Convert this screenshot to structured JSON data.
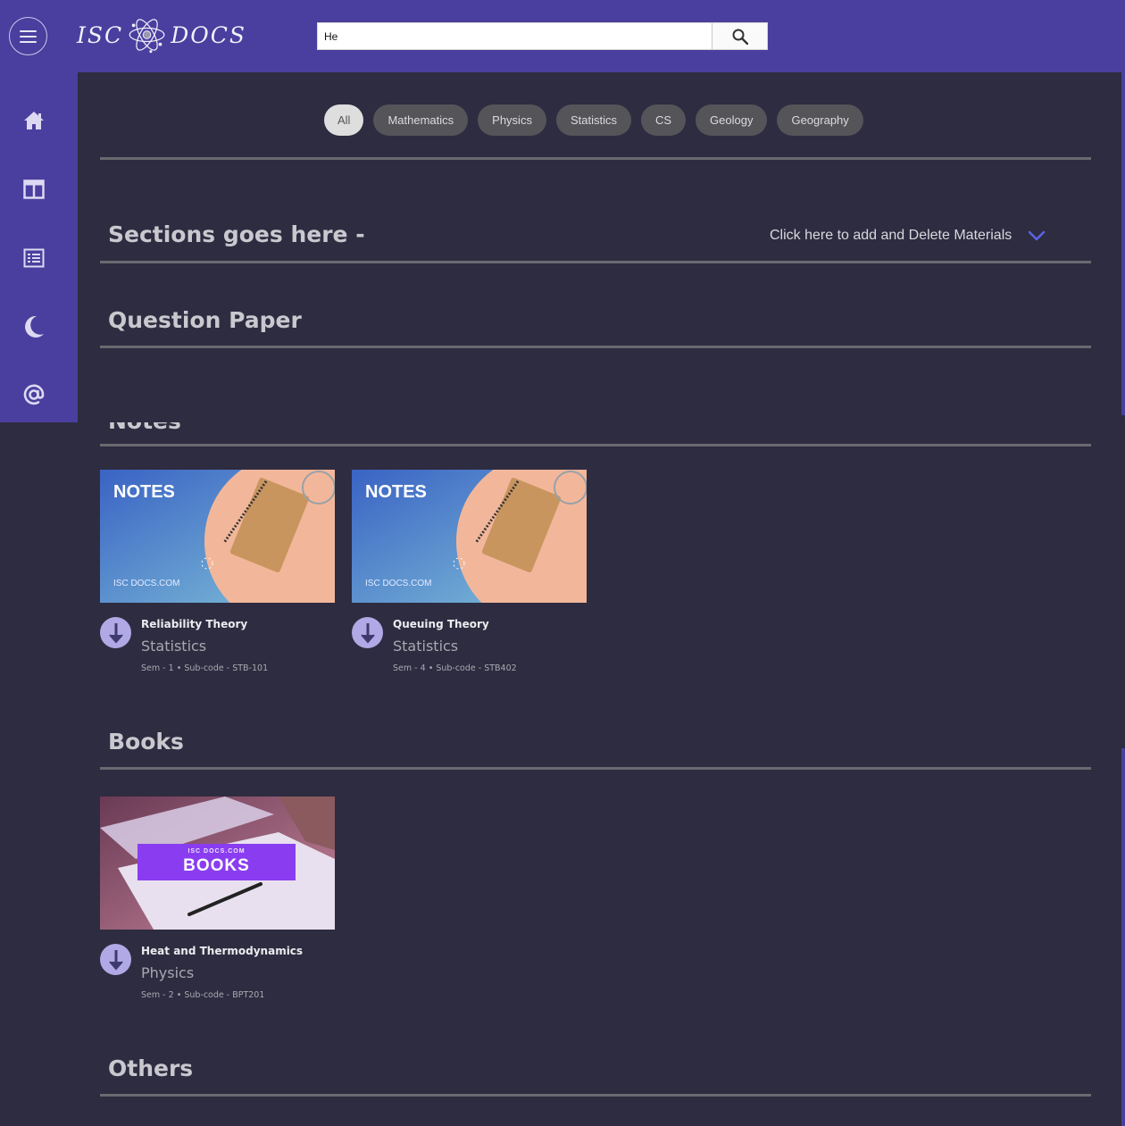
{
  "header": {
    "logo_left": "ISC",
    "logo_right": "DOCS",
    "search": {
      "value": "He"
    }
  },
  "sidebar": {
    "items": [
      {
        "name": "home",
        "icon": "home-icon"
      },
      {
        "name": "dashboard",
        "icon": "columns-icon"
      },
      {
        "name": "list",
        "icon": "list-icon"
      },
      {
        "name": "theme",
        "icon": "moon-icon"
      },
      {
        "name": "contact",
        "icon": "at-icon"
      }
    ]
  },
  "filters": [
    "All",
    "Mathematics",
    "Physics",
    "Statistics",
    "CS",
    "Geology",
    "Geography"
  ],
  "sections": {
    "title": "Sections goes here -",
    "add_link": "Click here to add and Delete Materials",
    "question_paper": "Question Paper",
    "notes": "Notes",
    "books": "Books",
    "others": "Others"
  },
  "notes": [
    {
      "thumb_label": "NOTES",
      "thumb_site": "ISC DOCS.COM",
      "title": "Reliability Theory",
      "subject": "Statistics",
      "sem": "Sem - 1",
      "subcode": "Sub-code - STB-101"
    },
    {
      "thumb_label": "NOTES",
      "thumb_site": "ISC DOCS.COM",
      "title": "Queuing Theory",
      "subject": "Statistics",
      "sem": "Sem - 4",
      "subcode": "Sub-code - STB402"
    }
  ],
  "books": [
    {
      "thumb_site": "ISC DOCS.COM",
      "thumb_label": "BOOKS",
      "title": "Heat and Thermodynamics",
      "subject": "Physics",
      "sem": "Sem - 2",
      "subcode": "Sub-code - BPT201"
    }
  ],
  "colors": {
    "header": "#4a3f9e",
    "background": "#2e2c40",
    "accent": "#5b63e6"
  }
}
